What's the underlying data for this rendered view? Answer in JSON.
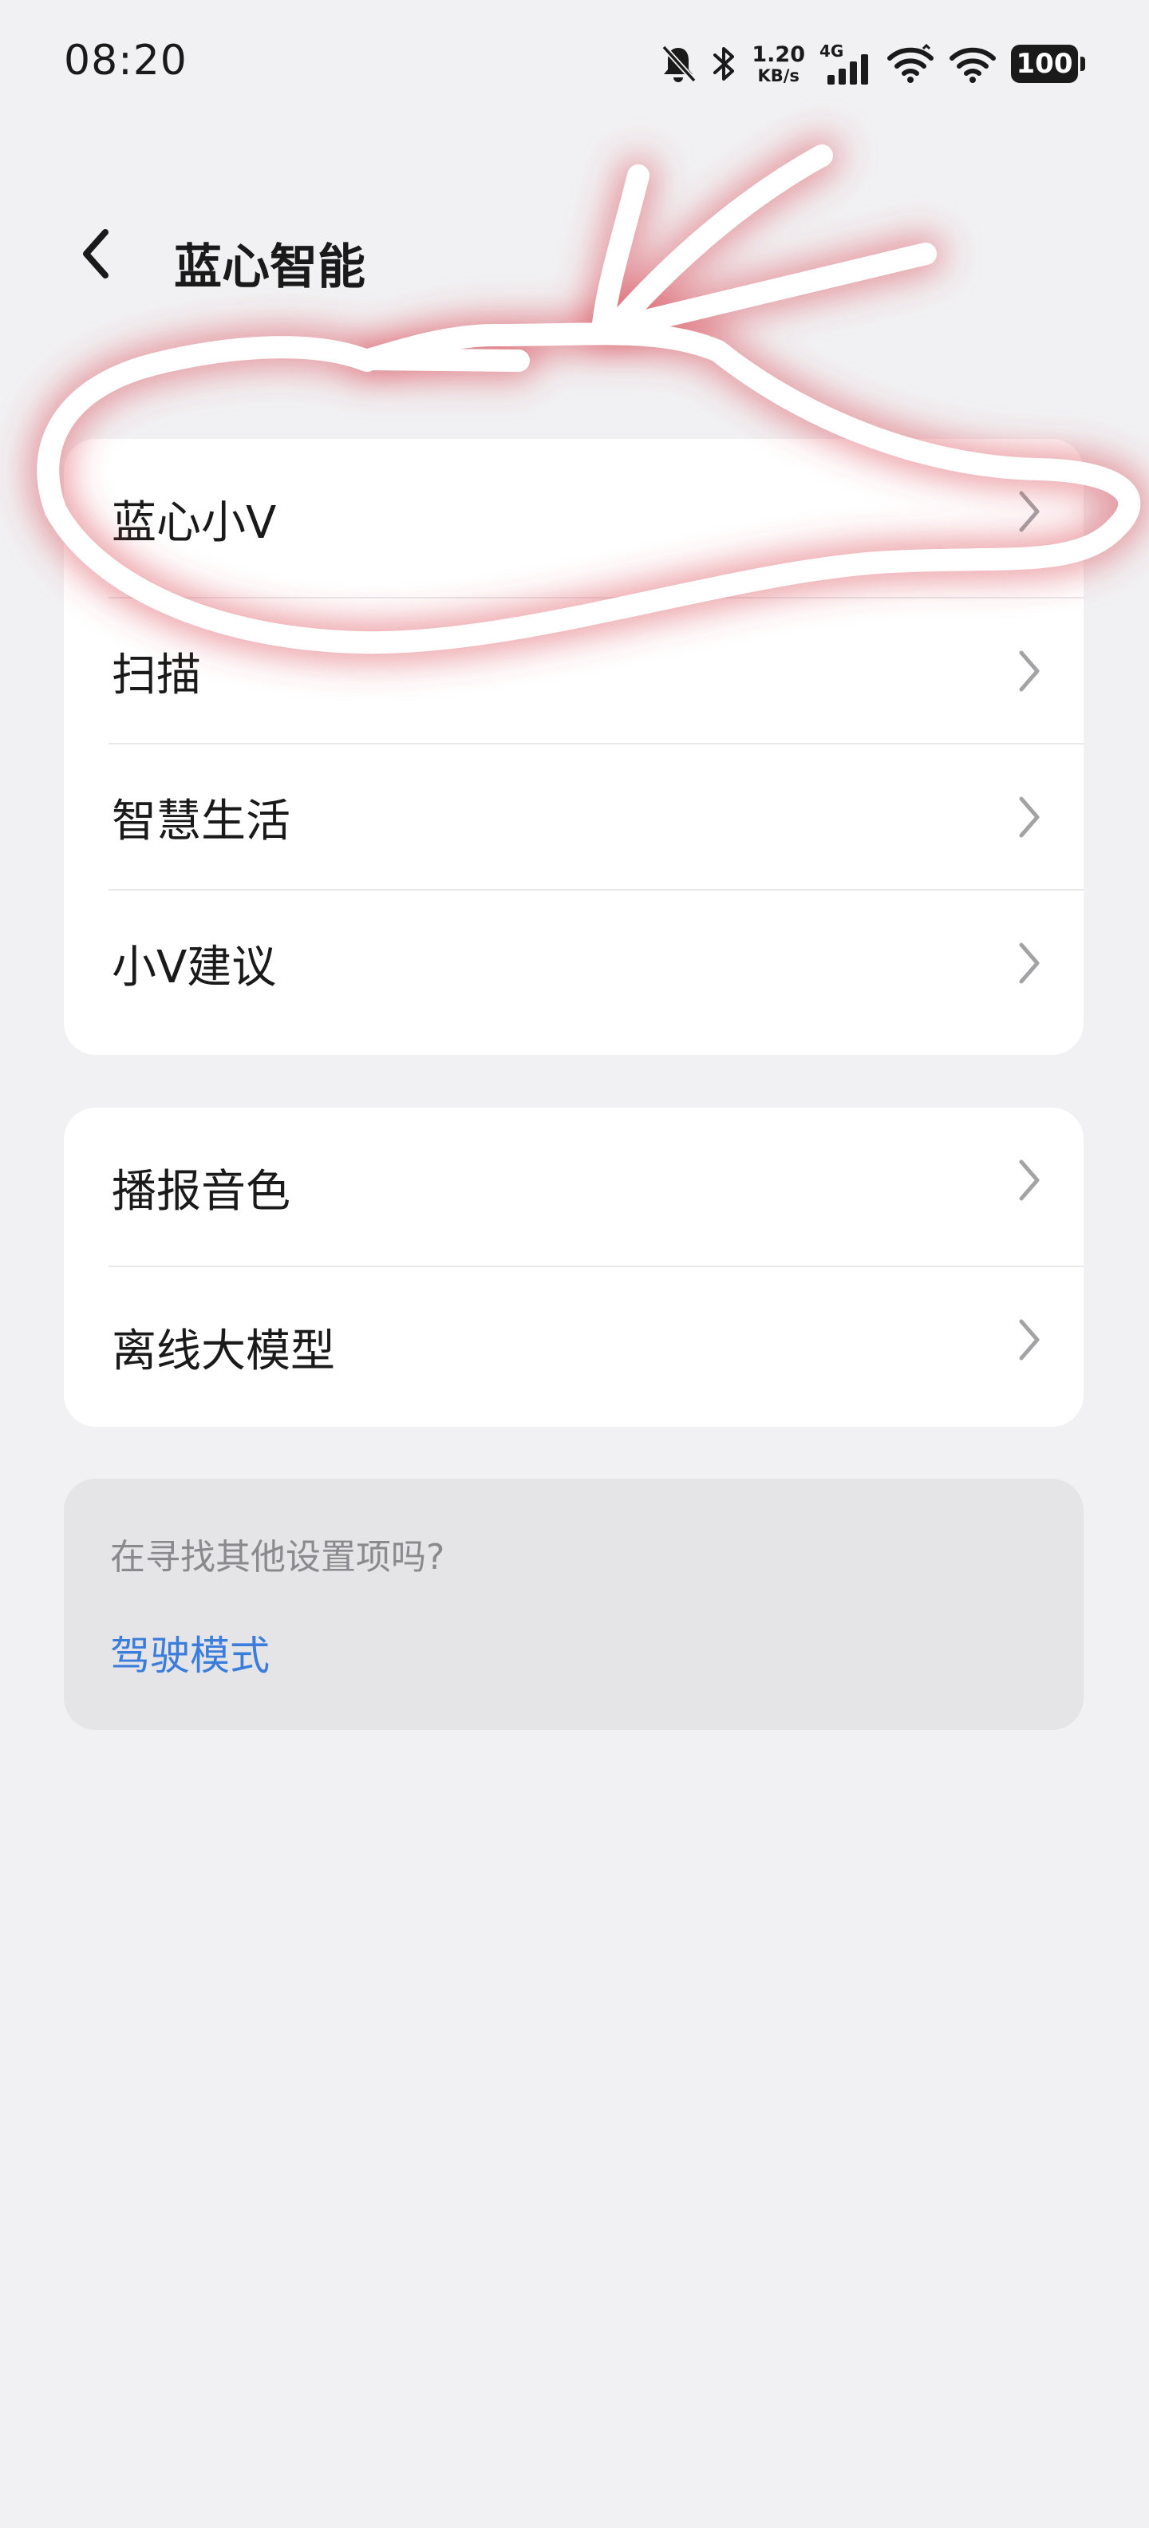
{
  "status_bar": {
    "time": "08:20",
    "net_speed_value": "1.20",
    "net_speed_unit": "KB/s",
    "network_type": "4G",
    "battery": "100"
  },
  "header": {
    "title": "蓝心智能"
  },
  "groups": [
    {
      "items": [
        {
          "label": "蓝心小V"
        },
        {
          "label": "扫描"
        },
        {
          "label": "智慧生活"
        },
        {
          "label": "小V建议"
        }
      ]
    },
    {
      "items": [
        {
          "label": "播报音色"
        },
        {
          "label": "离线大模型"
        }
      ]
    }
  ],
  "suggestion": {
    "hint": "在寻找其他设置项吗?",
    "link": "驾驶模式"
  },
  "icons": {
    "back": "chevron-left-icon",
    "row_arrow": "chevron-right-icon",
    "mute": "bell-off-icon",
    "bluetooth": "bluetooth-icon",
    "signal": "cellular-signal-icon",
    "wifi": "wifi-icon",
    "battery": "battery-icon"
  },
  "colors": {
    "background": "#f1f1f3",
    "card": "#ffffff",
    "link": "#3b7ddd",
    "annotation_stroke": "#ffffff",
    "annotation_glow": "#d9434f"
  }
}
